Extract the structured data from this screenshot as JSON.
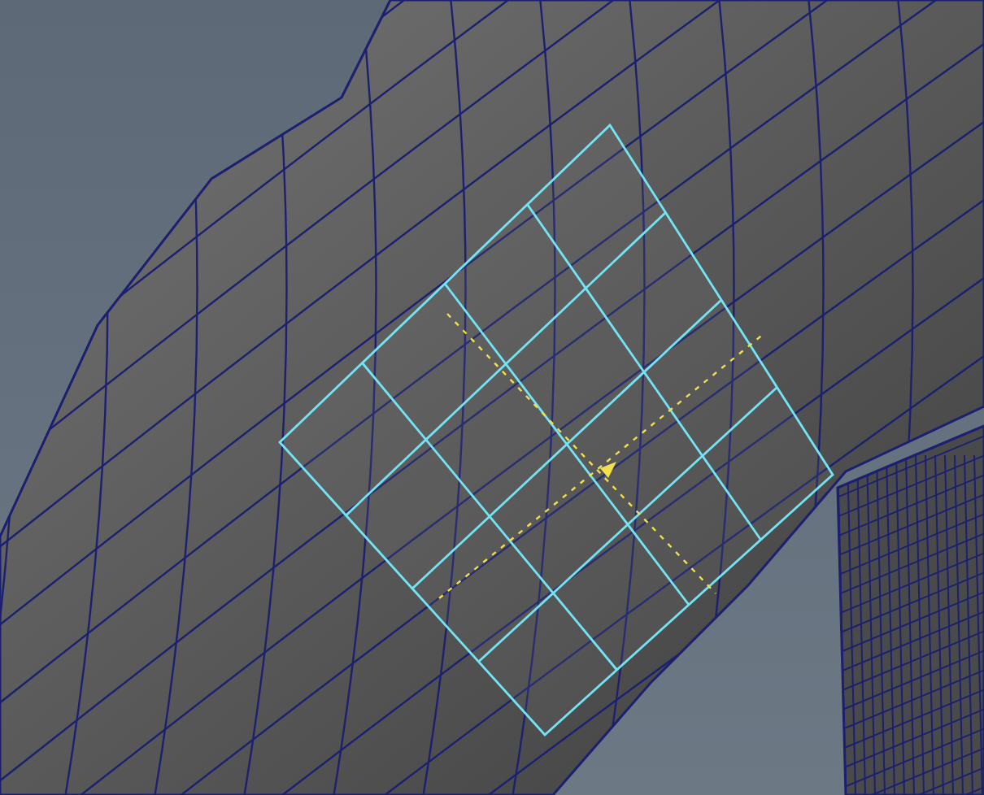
{
  "viewport": {
    "selection": {
      "highlighted": true
    }
  }
}
